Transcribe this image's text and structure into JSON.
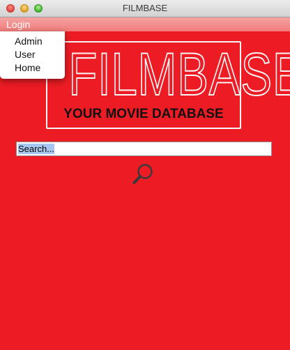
{
  "window": {
    "title": "FILMBASE"
  },
  "menubar": {
    "login": "Login"
  },
  "menu": {
    "items": [
      "Admin",
      "User",
      "Home"
    ]
  },
  "logo": {
    "title": "FILMBASE",
    "subtitle": "YOUR MOVIE DATABASE"
  },
  "search": {
    "value": "Search..."
  },
  "colors": {
    "background": "#ed1c24",
    "menubar": "#f27c7c",
    "selection": "#a8c7f0"
  },
  "icons": {
    "search": "search-icon"
  }
}
